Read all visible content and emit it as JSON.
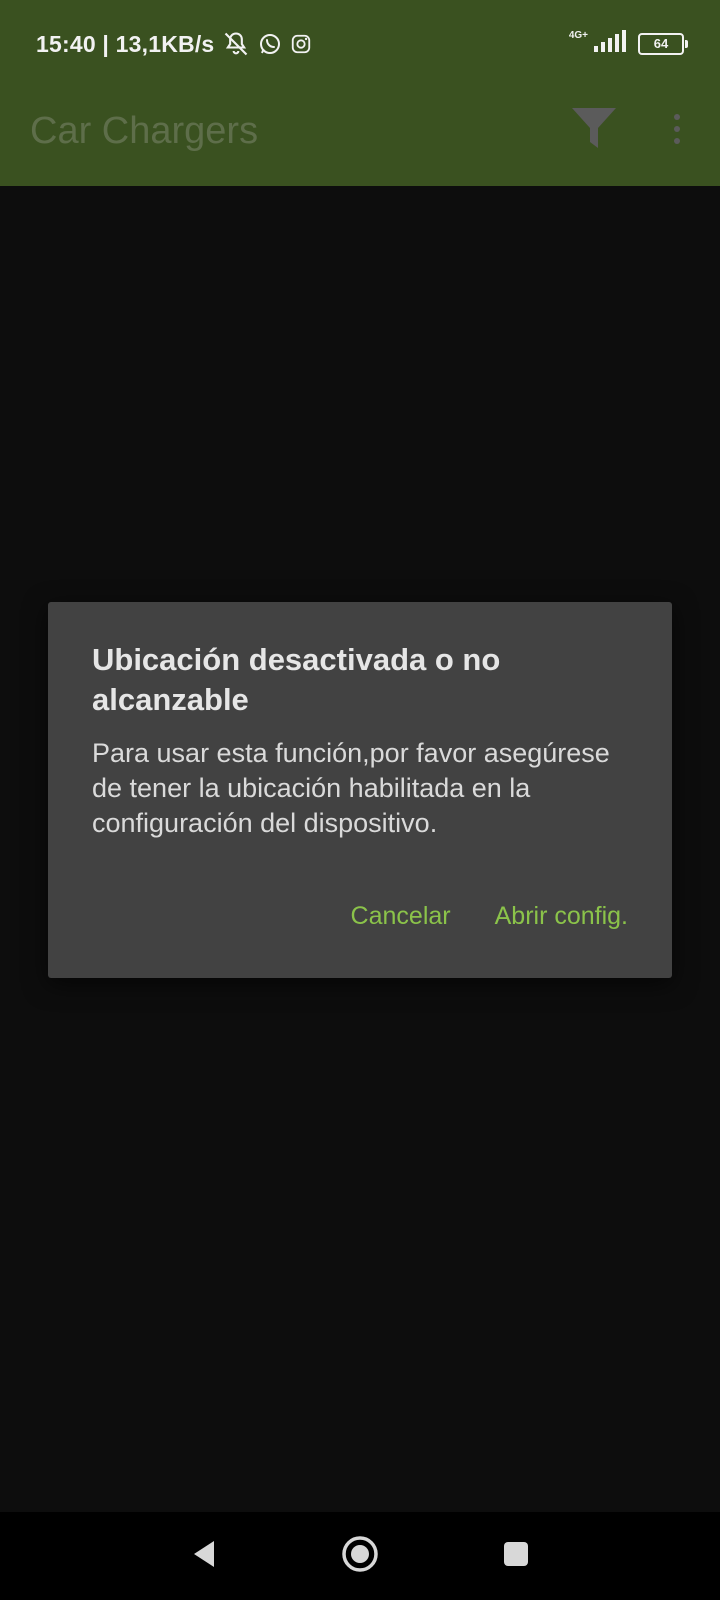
{
  "status_bar": {
    "time_and_speed": "15:40 | 13,1KB/s",
    "network_type": "4G+",
    "battery_level": "64",
    "icons": [
      "notifications-off-icon",
      "whatsapp-icon",
      "instagram-icon",
      "signal-icon",
      "battery-icon"
    ]
  },
  "app_bar": {
    "title": "Car Chargers",
    "filter_icon": "filter-icon",
    "overflow_icon": "more-vert-icon",
    "color": "#3a5120"
  },
  "dialog": {
    "title": "Ubicación desactivada o no alcanzable",
    "message": "Para usar esta función,por favor asegúrese de tener la ubicación habilitada en la configuración del dispositivo.",
    "cancel_label": "Cancelar",
    "confirm_label": "Abrir config.",
    "accent_color": "#8bc34a",
    "background_color": "#424242"
  },
  "nav_bar": {
    "back_icon": "back-triangle-icon",
    "home_icon": "home-circle-icon",
    "recents_icon": "recents-square-icon"
  }
}
